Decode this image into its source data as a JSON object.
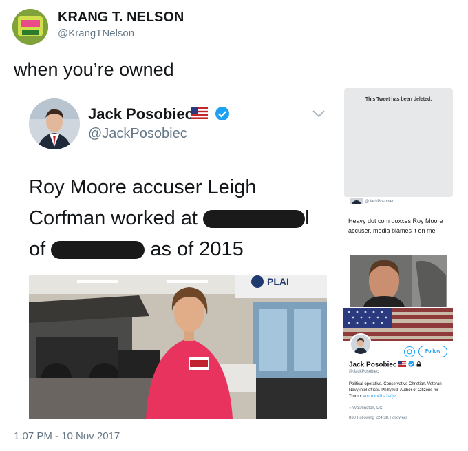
{
  "outer_tweet": {
    "name": "KRANG T. NELSON",
    "handle": "@KrangTNelson",
    "text": "when you’re owned",
    "timestamp": "1:07 PM - 10 Nov 2017"
  },
  "embedded_tweet": {
    "name": "Jack Posobiec",
    "handle": "@JackPosobiec",
    "line1": "Roy Moore accuser Leigh",
    "line2_a": "Corfman worked at",
    "line2_b": "l",
    "line3_a": "of",
    "line3_b": "as of 2015",
    "photo_sign": "P̲LAI"
  },
  "side_panel": {
    "deleted_notice": "This Tweet has been deleted.",
    "mini_handle": "@JackPosobiec",
    "mini_text": "Heavy dot com doxxes Roy Moore accuser, media blames it on me",
    "profile": {
      "follow_label": "Follow",
      "name": "Jack Posobiec",
      "handle": "@JackPosobiec",
      "bio": "Political operative. Conservative Christian. Veteran Navy intel officer. Philly kid. Author of Citizens for Trump:",
      "bio_link": "amzn.to/2ha2aQv",
      "location": "Washington, DC",
      "stats": "830 Following     224.3K Followers"
    }
  },
  "colors": {
    "twitter_blue": "#1da1f2",
    "muted_text": "#657786",
    "redaction": "#1a1a1a",
    "shirt_pink": "#e8335f"
  }
}
